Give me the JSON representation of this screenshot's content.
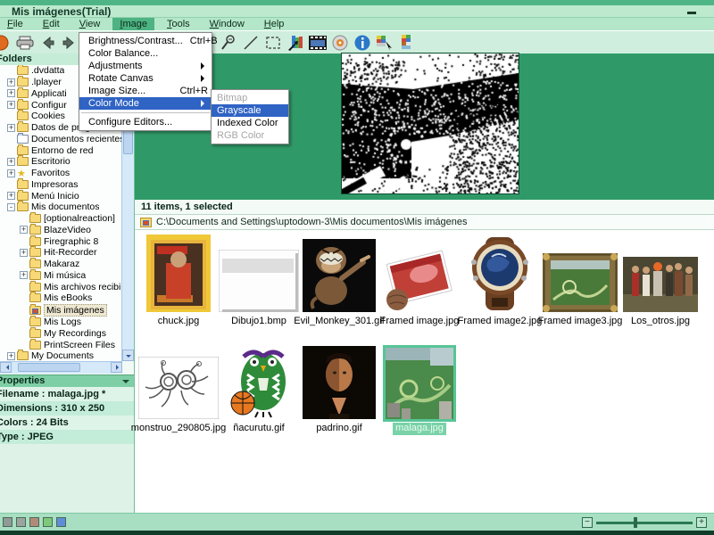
{
  "window": {
    "title": "Mis imágenes(Trial)"
  },
  "menubar": {
    "items": [
      "File",
      "Edit",
      "View",
      "Image",
      "Tools",
      "Window",
      "Help"
    ],
    "active_item": "Image"
  },
  "toolbar": {
    "left_icons": [
      "app-logo-ball",
      "print",
      "back",
      "forward"
    ],
    "right_icons": [
      "zoom-in",
      "zoom-out",
      "line-tool",
      "selection-marquee",
      "histogram-export",
      "filmstrip",
      "disc-burn",
      "info",
      "palette-pick",
      "palette"
    ]
  },
  "image_menu": {
    "items": [
      {
        "label": "Brightness/Contrast...",
        "shortcut": "Ctrl+B"
      },
      {
        "label": "Color Balance...",
        "shortcut": ""
      },
      {
        "label": "Adjustments",
        "shortcut": ""
      },
      {
        "label": "Rotate Canvas",
        "shortcut": ""
      },
      {
        "label": "Image Size...",
        "shortcut": "Ctrl+R"
      },
      {
        "label": "Color Mode",
        "shortcut": ""
      },
      {
        "label": "Configure Editors...",
        "shortcut": ""
      }
    ],
    "highlighted_item": "Color Mode"
  },
  "color_mode_submenu": {
    "items": [
      {
        "label": "Bitmap",
        "state": "disabled"
      },
      {
        "label": "Grayscale",
        "state": "highlighted"
      },
      {
        "label": "Indexed Color",
        "state": "normal"
      },
      {
        "label": "RGB Color",
        "state": "disabled"
      }
    ]
  },
  "folders_panel": {
    "title": "Folders",
    "items": [
      {
        "label": ".dvdatta"
      },
      {
        "label": ".lplayer"
      },
      {
        "label": "Applicati"
      },
      {
        "label": "Configur"
      },
      {
        "label": "Cookies"
      },
      {
        "label": "Datos de programa"
      },
      {
        "label": "Documentos recientes"
      },
      {
        "label": "Entorno de red"
      },
      {
        "label": "Escritorio"
      },
      {
        "label": "Favoritos"
      },
      {
        "label": "Impresoras"
      },
      {
        "label": "Menú Inicio"
      },
      {
        "label": "Mis documentos"
      },
      {
        "label": "[optionalreaction]"
      },
      {
        "label": "BlazeVideo"
      },
      {
        "label": "Firegraphic 8"
      },
      {
        "label": "Hit-Recorder"
      },
      {
        "label": "Makaraz"
      },
      {
        "label": "Mi música"
      },
      {
        "label": "Mis archivos recibi"
      },
      {
        "label": "Mis eBooks"
      },
      {
        "label": "Mis imágenes"
      },
      {
        "label": "Mis Logs"
      },
      {
        "label": "My Recordings"
      },
      {
        "label": "PrintScreen Files"
      },
      {
        "label": "My Documents"
      }
    ],
    "selected_item": "Mis imágenes"
  },
  "properties_panel": {
    "title": "Properties",
    "rows": [
      "Filename : malaga.jpg *",
      "Dimensions : 310 x 250",
      "Colors : 24 Bits",
      "Type : JPEG"
    ]
  },
  "status_strip": {
    "text": "11 items, 1 selected"
  },
  "address_bar": {
    "path": "C:\\Documents and Settings\\uptodown-3\\Mis documentos\\Mis imágenes"
  },
  "file_grid": {
    "files": [
      {
        "name": "chuck.jpg"
      },
      {
        "name": "Dibujo1.bmp"
      },
      {
        "name": "Evil_Monkey_301.gif"
      },
      {
        "name": "Framed image.jpg"
      },
      {
        "name": "Framed image2.jpg"
      },
      {
        "name": "Framed image3.jpg"
      },
      {
        "name": "Los_otros.jpg"
      },
      {
        "name": "monstruo_290805.jpg"
      },
      {
        "name": "ñacurutu.gif"
      },
      {
        "name": "padrino.gif"
      },
      {
        "name": "malaga.jpg"
      }
    ],
    "selected_file": "malaga.jpg"
  },
  "colors": {
    "accent_green": "#2f9a68",
    "chrome_light_green": "#bdeacf",
    "menu_highlight_blue": "#2f63c4",
    "selection_teal": "#79d2a8"
  }
}
